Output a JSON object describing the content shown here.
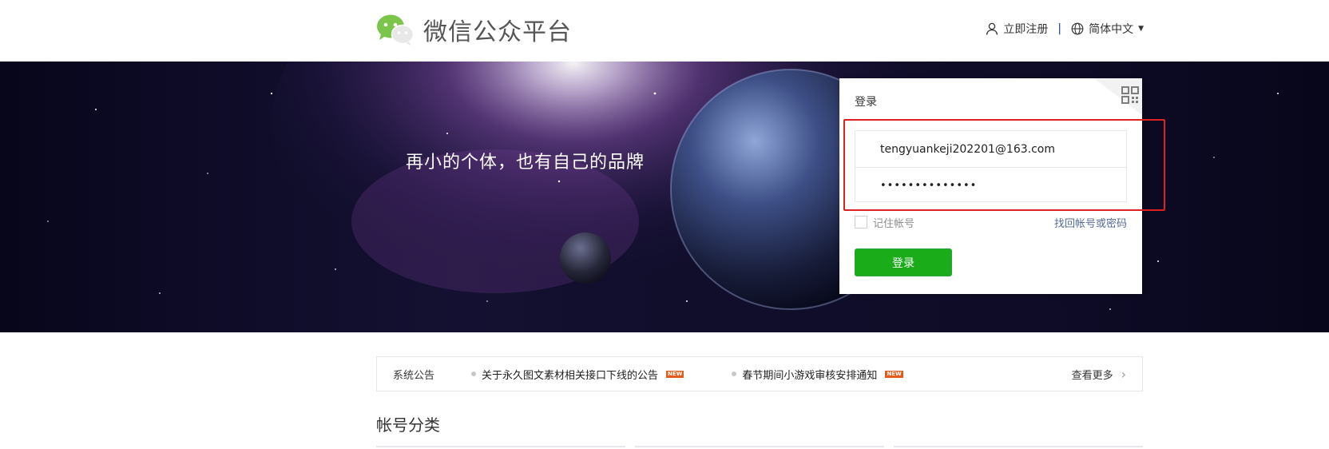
{
  "header": {
    "logo_text": "微信公众平台",
    "register_label": "立即注册",
    "separator": "|",
    "language_label": "简体中文",
    "language_caret": "▼"
  },
  "banner": {
    "slogan": "再小的个体，也有自己的品牌"
  },
  "login": {
    "title": "登录",
    "account_value": "tengyuankeji202201@163.com",
    "password_value": "••••••••••••••",
    "remember_label": "记住帐号",
    "forgot_label": "找回帐号或密码",
    "button_label": "登录"
  },
  "notice": {
    "label": "系统公告",
    "items": [
      {
        "text": "关于永久图文素材相关接口下线的公告",
        "badge": "NEW"
      },
      {
        "text": "春节期间小游戏审核安排通知",
        "badge": "NEW"
      }
    ],
    "more_label": "查看更多",
    "more_icon": "›"
  },
  "section": {
    "title": "帐号分类"
  },
  "colors": {
    "primary_green": "#1aad19",
    "link_blue": "#576b95",
    "highlight_red": "#e0201e",
    "badge_orange": "#e65a1c"
  }
}
